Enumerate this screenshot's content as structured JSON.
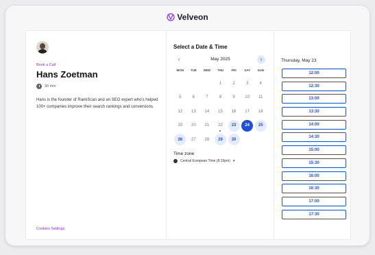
{
  "brand": {
    "name": "Velveon",
    "color": "#8a2be2"
  },
  "host": {
    "event_label": "Book a Call",
    "name": "Hans Zoetman",
    "duration": "30 min",
    "description": "Hans is the founder of RankScan and an SEO expert who's helped 100+ companies improve their search rankings and conversions."
  },
  "footer": {
    "cookies_label": "Cookies Settings"
  },
  "calendar": {
    "title": "Select a Date & Time",
    "month": "May 2025",
    "prev_icon": "chevron-left-icon",
    "next_icon": "chevron-right-icon",
    "weekdays": [
      "MON",
      "TUE",
      "WED",
      "THU",
      "FRI",
      "SAT",
      "SUN"
    ],
    "days": [
      {
        "num": "",
        "state": "empty"
      },
      {
        "num": "",
        "state": "empty"
      },
      {
        "num": "",
        "state": "empty"
      },
      {
        "num": "1",
        "state": "past"
      },
      {
        "num": "2",
        "state": "past"
      },
      {
        "num": "3",
        "state": "past"
      },
      {
        "num": "4",
        "state": "past"
      },
      {
        "num": "5",
        "state": "past"
      },
      {
        "num": "6",
        "state": "past"
      },
      {
        "num": "7",
        "state": "past"
      },
      {
        "num": "8",
        "state": "past"
      },
      {
        "num": "9",
        "state": "past"
      },
      {
        "num": "10",
        "state": "past"
      },
      {
        "num": "11",
        "state": "past"
      },
      {
        "num": "12",
        "state": "past"
      },
      {
        "num": "13",
        "state": "past"
      },
      {
        "num": "14",
        "state": "past"
      },
      {
        "num": "15",
        "state": "past"
      },
      {
        "num": "16",
        "state": "past"
      },
      {
        "num": "17",
        "state": "past"
      },
      {
        "num": "18",
        "state": "past"
      },
      {
        "num": "19",
        "state": "past"
      },
      {
        "num": "20",
        "state": "past"
      },
      {
        "num": "21",
        "state": "past"
      },
      {
        "num": "22",
        "state": "today"
      },
      {
        "num": "23",
        "state": "available"
      },
      {
        "num": "24",
        "state": "selected"
      },
      {
        "num": "25",
        "state": "available"
      },
      {
        "num": "26",
        "state": "available"
      },
      {
        "num": "27",
        "state": "past"
      },
      {
        "num": "28",
        "state": "past"
      },
      {
        "num": "29",
        "state": "available"
      },
      {
        "num": "30",
        "state": "available"
      },
      {
        "num": "",
        "state": "empty"
      },
      {
        "num": "",
        "state": "empty"
      },
      {
        "num": "",
        "state": "empty"
      },
      {
        "num": "",
        "state": "empty"
      }
    ],
    "accent_color": "#1f4ed8",
    "available_bg": "#e4ebfc"
  },
  "timezone": {
    "title": "Time zone",
    "value": "Central European Time (8:19pm)"
  },
  "slots": {
    "date_title": "Thursday, May 23",
    "times": [
      "12:00",
      "12:30",
      "13:00",
      "13:30",
      "14:00",
      "14:30",
      "15:00",
      "15:30",
      "16:00",
      "16:30",
      "17:00",
      "17:30"
    ]
  }
}
